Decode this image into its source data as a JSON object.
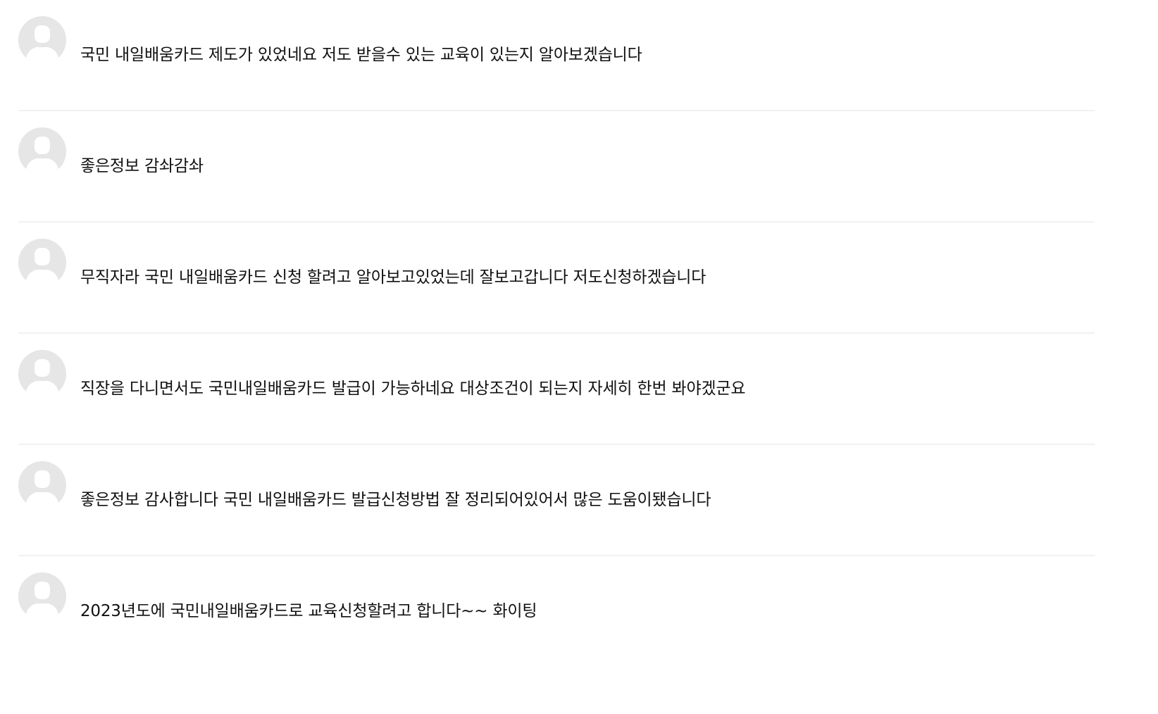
{
  "comments": [
    {
      "avatar_icon": "default-user-avatar-icon",
      "text": "국민 내일배움카드 제도가 있었네요 저도 받을수 있는 교육이 있는지 알아보겠습니다"
    },
    {
      "avatar_icon": "default-user-avatar-icon",
      "text": "좋은정보 감솨감솨"
    },
    {
      "avatar_icon": "default-user-avatar-icon",
      "text": "무직자라 국민 내일배움카드 신청 할려고 알아보고있었는데 잘보고갑니다 저도신청하겠습니다"
    },
    {
      "avatar_icon": "default-user-avatar-icon",
      "text": "직장을 다니면서도 국민내일배움카드 발급이 가능하네요 대상조건이 되는지 자세히 한번 봐야겠군요"
    },
    {
      "avatar_icon": "default-user-avatar-icon",
      "text": "좋은정보 감사합니다 국민 내일배움카드 발급신청방법 잘 정리되어있어서 많은 도움이됐습니다"
    },
    {
      "avatar_icon": "default-user-avatar-icon",
      "text": "2023년도에 국민내일배움카드로 교육신청할려고 합니다~~ 화이팅"
    }
  ],
  "colors": {
    "background": "#ffffff",
    "text": "#111111",
    "avatar_bg": "#e6e6e6",
    "avatar_figure": "#ffffff",
    "divider": "#f1f1f1"
  }
}
